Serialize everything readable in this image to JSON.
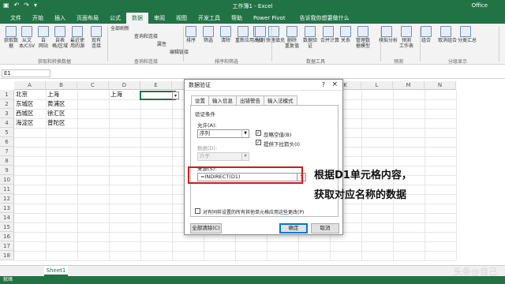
{
  "app": {
    "window_title": "工作簿1 - Excel",
    "brand": "Office",
    "qat_icons": [
      "save-icon",
      "undo-icon",
      "redo-icon",
      "customize-icon"
    ]
  },
  "tabs": [
    "文件",
    "开始",
    "插入",
    "页面布局",
    "公式",
    "数据",
    "审阅",
    "视图",
    "开发工具",
    "帮助",
    "Power Pivot"
  ],
  "active_tab": "数据",
  "tell_me": "告诉我你想要做什么",
  "ribbon": {
    "buttons": [
      {
        "label": "获取数\n据"
      },
      {
        "label": "从文\n本/CSV"
      },
      {
        "label": "自\n网站"
      },
      {
        "label": "自表\n格/区域"
      },
      {
        "label": "最近使\n用的源"
      },
      {
        "label": "现有\n连接"
      },
      {
        "label": "全部刷新"
      },
      {
        "label": "查询和连接"
      },
      {
        "label": "属性"
      },
      {
        "label": "编辑链接"
      },
      {
        "label": "排序"
      },
      {
        "label": "筛选"
      },
      {
        "label": "清除"
      },
      {
        "label": "重新应用"
      },
      {
        "label": "高级"
      },
      {
        "label": "分列"
      },
      {
        "label": "快速填充"
      },
      {
        "label": "删除\n重复值"
      },
      {
        "label": "数据验\n证"
      },
      {
        "label": "合并计算"
      },
      {
        "label": "关系"
      },
      {
        "label": "管理数\n据模型"
      },
      {
        "label": "模拟分析"
      },
      {
        "label": "预测\n工作表"
      },
      {
        "label": "组合"
      },
      {
        "label": "取消组合"
      },
      {
        "label": "分类汇总"
      }
    ],
    "groups": [
      "获取和转换数据",
      "查询和连接",
      "排序和筛选",
      "数据工具",
      "预测",
      "分级显示"
    ]
  },
  "name_box": "E1",
  "columns": [
    "A",
    "B",
    "C",
    "D",
    "E",
    "F",
    "G",
    "H",
    "I",
    "J",
    "K",
    "L",
    "M",
    "N"
  ],
  "rows": [
    "1",
    "2",
    "3",
    "4",
    "5",
    "6",
    "7",
    "8",
    "9",
    "10",
    "11",
    "12",
    "13",
    "14",
    "15",
    "16",
    "17",
    "18"
  ],
  "cells": {
    "A1": "北京",
    "B1": "上海",
    "D1": "上海",
    "A2": "东城区",
    "B2": "黄浦区",
    "A3": "西城区",
    "B3": "徐汇区",
    "A4": "海淀区",
    "B4": "普陀区"
  },
  "sheet_tab": "Sheet1",
  "status": "就绪",
  "dialog": {
    "title": "数据验证",
    "help": "?",
    "close": "×",
    "tabs": [
      "设置",
      "输入信息",
      "出错警告",
      "输入法模式"
    ],
    "section": "验证条件",
    "allow_label": "允许(A):",
    "allow_value": "序列",
    "data_label": "数据(D):",
    "data_value": "介于",
    "ignore_blank": "忽略空值(B)",
    "dropdown": "提供下拉箭头(I)",
    "source_label": "来源(S):",
    "source_value": "=INDIRECT(D1)",
    "apply_all": "对有同样设置的所有其他单元格应用这些更改(P)",
    "clear_all": "全部清除(C)",
    "ok": "确定",
    "cancel": "取消"
  },
  "annotation": {
    "line1": "根据D1单元格内容，",
    "line2": "获取对应名称的数据"
  },
  "watermark": "头条@自己",
  "colors": {
    "excel_green": "#217346",
    "highlight_red": "#d11919"
  }
}
